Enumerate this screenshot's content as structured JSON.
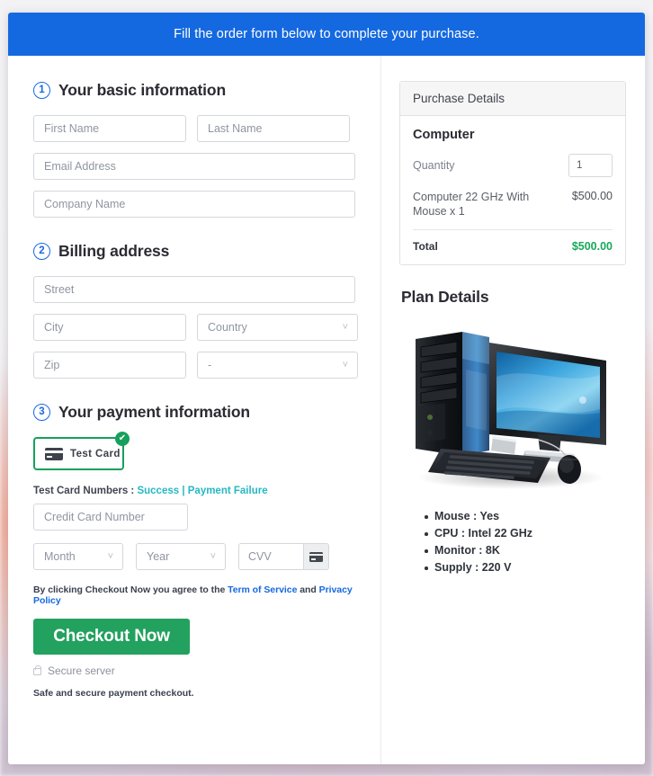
{
  "banner": {
    "text": "Fill the order form below to complete your purchase."
  },
  "form": {
    "section1": {
      "number": "1",
      "title": "Your basic information",
      "fields": {
        "first_name": "First Name",
        "last_name": "Last Name",
        "email": "Email Address",
        "company": "Company Name"
      }
    },
    "section2": {
      "number": "2",
      "title": "Billing address",
      "fields": {
        "street": "Street",
        "city": "City",
        "country": "Country",
        "zip": "Zip",
        "state": "-"
      }
    },
    "section3": {
      "number": "3",
      "title": "Your payment information",
      "test_card": {
        "label": "Test  Card",
        "check": "✔"
      },
      "test_numbers": {
        "prefix": "Test Card Numbers : ",
        "success": "Success",
        "separator": " | ",
        "failure": "Payment Failure"
      },
      "fields": {
        "card_number": "Credit Card Number",
        "month": "Month",
        "year": "Year",
        "cvv": "CVV"
      }
    },
    "terms": {
      "before": "By clicking Checkout Now you agree to the ",
      "tos": "Term of Service",
      "middle": " and ",
      "privacy": "Privacy Policy"
    },
    "checkout_button": "Checkout Now",
    "secure_server": "Secure server",
    "safe_note": "Safe and secure payment checkout."
  },
  "sidebar": {
    "purchase_details": {
      "header": "Purchase Details",
      "product_name": "Computer",
      "quantity_label": "Quantity",
      "quantity_value": "1",
      "line_item_desc": "Computer 22 GHz With Mouse x 1",
      "line_item_amount": "$500.00",
      "total_label": "Total",
      "total_amount": "$500.00"
    },
    "plan_details": {
      "title": "Plan Details",
      "specs": [
        "Mouse : Yes",
        "CPU : Intel 22 GHz",
        "Monitor : 8K",
        "Supply : 220 V"
      ]
    }
  },
  "colors": {
    "banner_blue": "#1569e0",
    "accent_green": "#23a15e",
    "total_green": "#18a85c",
    "link_teal": "#24b8c4",
    "link_blue": "#1569e0"
  }
}
